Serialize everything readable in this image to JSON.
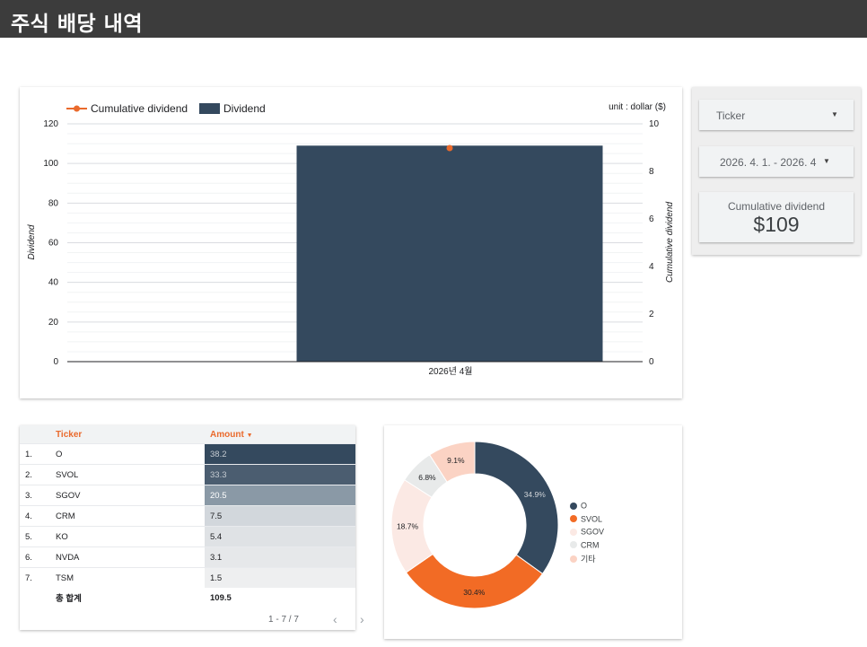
{
  "header": {
    "title": "주식 배당 내역"
  },
  "combo_chart": {
    "legend": {
      "line_label": "Cumulative dividend",
      "bar_label": "Dividend"
    },
    "unit_note": "unit : dollar ($)",
    "left_axis_title": "Dividend",
    "right_axis_title": "Cumulative dividend",
    "left_ticks": [
      "0",
      "20",
      "40",
      "60",
      "80",
      "100",
      "120"
    ],
    "right_ticks": [
      "0",
      "2",
      "4",
      "6",
      "8",
      "10"
    ],
    "x_tick": "2026년 4월"
  },
  "filters": {
    "ticker": {
      "label": "Ticker"
    },
    "date_range": {
      "label": "2026. 4. 1. - 2026. 4"
    },
    "scorecard": {
      "label": "Cumulative dividend",
      "value": "$109"
    }
  },
  "table": {
    "headers": {
      "ticker": "Ticker",
      "amount": "Amount"
    },
    "rows": [
      {
        "idx": "1.",
        "ticker": "O",
        "amount": "38.2"
      },
      {
        "idx": "2.",
        "ticker": "SVOL",
        "amount": "33.3"
      },
      {
        "idx": "3.",
        "ticker": "SGOV",
        "amount": "20.5"
      },
      {
        "idx": "4.",
        "ticker": "CRM",
        "amount": "7.5"
      },
      {
        "idx": "5.",
        "ticker": "KO",
        "amount": "5.4"
      },
      {
        "idx": "6.",
        "ticker": "NVDA",
        "amount": "3.1"
      },
      {
        "idx": "7.",
        "ticker": "TSM",
        "amount": "1.5"
      }
    ],
    "total": {
      "label": "총 합계",
      "value": "109.5"
    },
    "pagination": "1 - 7 / 7"
  },
  "colors": {
    "bar": "#34495e",
    "line": "#ea6a2c",
    "accent": "#ea6a2c",
    "header_bg": "#3c3c3c"
  },
  "chart_data": [
    {
      "type": "bar",
      "categories": [
        "2026년 4월"
      ],
      "series": [
        {
          "name": "Dividend",
          "type": "bar",
          "axis": "left",
          "values": [
            109
          ]
        },
        {
          "name": "Cumulative dividend",
          "type": "line",
          "axis": "right",
          "values": [
            109
          ]
        }
      ],
      "xlabel": "",
      "ylabel": "Dividend",
      "y2label": "Cumulative dividend",
      "ylim": [
        0,
        120
      ],
      "y2lim": [
        0,
        10
      ],
      "grid": true,
      "legend": "top-left"
    },
    {
      "type": "pie",
      "donut": true,
      "slices": [
        {
          "name": "O",
          "value": 34.9,
          "label": "34.9%",
          "color": "#34495e"
        },
        {
          "name": "SVOL",
          "value": 30.4,
          "label": "30.4%",
          "color": "#f26b25"
        },
        {
          "name": "SGOV",
          "value": 18.7,
          "label": "18.7%",
          "color": "#fbe9e4"
        },
        {
          "name": "CRM",
          "value": 6.8,
          "label": "6.8%",
          "color": "#e8eaea"
        },
        {
          "name": "기타",
          "value": 9.1,
          "label": "9.1%",
          "color": "#fbd3c4"
        }
      ],
      "legend": "right"
    }
  ]
}
